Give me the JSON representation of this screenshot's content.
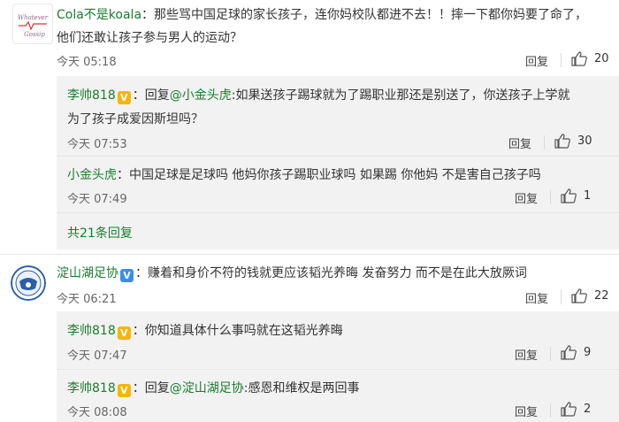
{
  "comments": [
    {
      "user": "Cola不是koala",
      "text_line1": "：那些骂中国足球的家长孩子，连你妈校队都进不去！！摔一下都你妈要了命了，",
      "text_line2": "他们还敢让孩子参与男人的运动？",
      "time": "今天 05:18",
      "reply_label": "回复",
      "likes": "20",
      "avatar_text": "Whatever Gossip",
      "replies": [
        {
          "user": "李帅818",
          "reply_prefix": "：回复",
          "reply_to": "@小金头虎",
          "text_line1": ":如果送孩子踢球就为了踢职业那还是别送了，你送孩子上学就",
          "text_line2": "为了孩子成爱因斯坦吗？",
          "time": "今天 07:53",
          "reply_label": "回复",
          "likes": "30"
        },
        {
          "user": "小金头虎",
          "text_line1": "：中国足球是足球吗 他妈你孩子踢职业球吗 如果踢 你他妈 不是害自己孩子吗",
          "time": "今天 07:49",
          "reply_label": "回复",
          "likes": "1"
        }
      ],
      "more_replies": "共21条回复"
    },
    {
      "user": "淀山湖足协",
      "text_line1": "：赚着和身价不符的钱就更应该韬光养晦 发奋努力 而不是在此大放厥词",
      "time": "今天 06:21",
      "reply_label": "回复",
      "likes": "22",
      "replies": [
        {
          "user": "李帅818",
          "text_line1": "：你知道具体什么事吗就在这韬光养晦",
          "time": "今天 07:47",
          "reply_label": "回复",
          "likes": "9"
        },
        {
          "user": "李帅818",
          "reply_prefix": "：回复",
          "reply_to": "@淀山湖足协",
          "text_line1": ":感恩和维权是两回事",
          "time": "今天 08:08",
          "reply_label": "回复",
          "likes": "2"
        }
      ]
    }
  ],
  "badge_letter": "V",
  "colors": {
    "name": "#1a7d2e",
    "badge": "#f7b500",
    "sub_bg": "#f2f2f2"
  },
  "icons": {
    "like": "thumbs-up-icon",
    "verified": "verified-badge-icon"
  }
}
